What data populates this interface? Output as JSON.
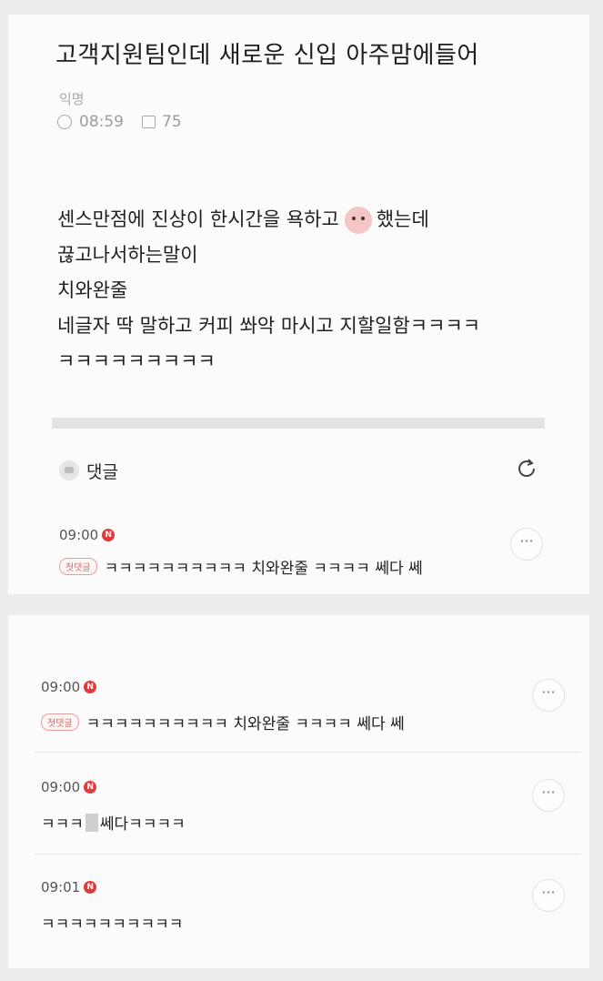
{
  "post": {
    "title": "고객지원팀인데 새로운 신입 아주맘에들어",
    "author": "익명",
    "time": "08:59",
    "views": "75",
    "body_line1_a": "센스만점에 진상이 한시간을 욕하고",
    "body_line1_b": "했는데",
    "body_line2": "끊고나서하는말이",
    "body_line3": "치와완줄",
    "body_line4": "네글자 딱 말하고 커피 쏴악 마시고 지할일함ㅋㅋㅋㅋ",
    "body_line5": "ㅋㅋㅋㅋㅋㅋㅋㅋㅋ"
  },
  "comments_section": {
    "label": "댓글"
  },
  "badge_letter": "N",
  "more_label": "···",
  "top_comment": {
    "time": "09:00",
    "badge": "첫댓글",
    "text": "ㅋㅋㅋㅋㅋㅋㅋㅋㅋㅋ 치와완줄 ㅋㅋㅋㅋ 쎄다 쎄"
  },
  "comments": [
    {
      "time": "09:00",
      "badge": "첫댓글",
      "text": "ㅋㅋㅋㅋㅋㅋㅋㅋㅋㅋ 치와완줄 ㅋㅋㅋㅋ 쎄다 쎄"
    },
    {
      "time": "09:00",
      "text_a": "ㅋㅋㅋ",
      "text_b": "쎄다ㅋㅋㅋㅋ"
    },
    {
      "time": "09:01",
      "text": "ㅋㅋㅋㅋㅋㅋㅋㅋㅋㅋ"
    }
  ]
}
